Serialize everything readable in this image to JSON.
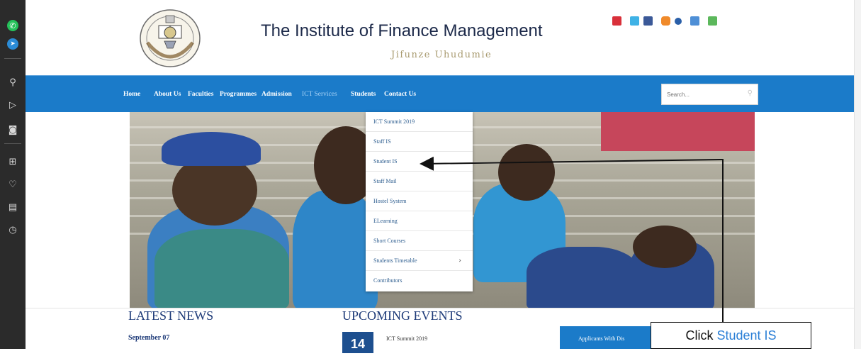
{
  "site": {
    "title": "The Institute of Finance Management",
    "tagline": "Jifunze Uhudumie"
  },
  "nav": {
    "items": [
      {
        "label": "Home"
      },
      {
        "label": "About Us"
      },
      {
        "label": "Faculties"
      },
      {
        "label": "Programmes"
      },
      {
        "label": "Admission"
      },
      {
        "label": "ICT Services"
      },
      {
        "label": "Students"
      },
      {
        "label": "Contact Us"
      }
    ],
    "active": "ICT Services",
    "search_placeholder": "Search..."
  },
  "dropdown": {
    "items": [
      {
        "label": "ICT Summit 2019"
      },
      {
        "label": "Staff IS"
      },
      {
        "label": "Student IS"
      },
      {
        "label": "Staff Mail"
      },
      {
        "label": "Hostel System"
      },
      {
        "label": "ELearning"
      },
      {
        "label": "Short Courses"
      },
      {
        "label": "Students Timetable",
        "submenu": true
      },
      {
        "label": "Contributors"
      }
    ]
  },
  "news": {
    "heading": "LATEST NEWS",
    "date": "September 07"
  },
  "events": {
    "heading": "UPCOMING EVENTS",
    "day": "14",
    "name": "ICT Summit 2019"
  },
  "apply_button": {
    "label": "Applicants With Dis"
  },
  "annotation": {
    "prefix": "Click ",
    "target": "Student IS"
  },
  "colors": {
    "nav_blue": "#1b7bc9",
    "title_navy": "#1d2a4a",
    "heading_blue": "#1d3a78",
    "dropdown_link": "#2d5d8f",
    "callout_highlight": "#2b7fd6"
  },
  "icons": {
    "sidebar": [
      "whatsapp-icon",
      "messenger-icon",
      "search-icon",
      "send-icon",
      "camera-icon",
      "grid-icon",
      "heart-icon",
      "news-icon",
      "clock-icon"
    ],
    "social": [
      "youtube-icon",
      "twitter-icon",
      "facebook-icon",
      "instagram-icon",
      "flickr-icon",
      "monitor-icon",
      "email-icon"
    ]
  }
}
